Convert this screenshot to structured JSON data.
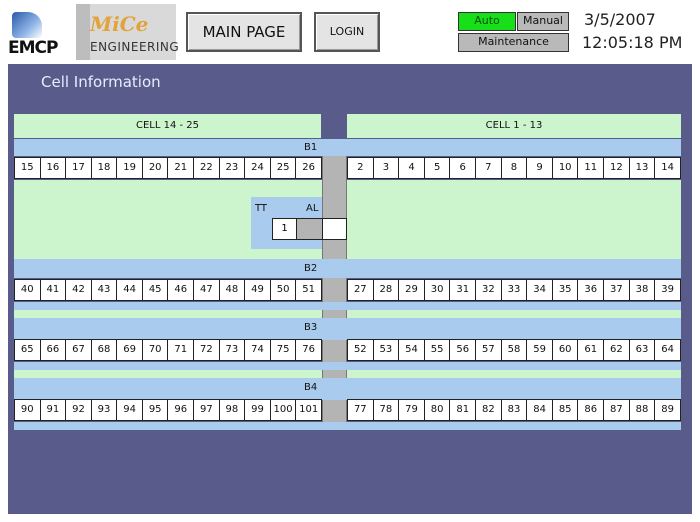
{
  "header": {
    "logo1_text": "EMCP",
    "logo2_brand": "MiCe",
    "logo2_sub": "ENGINEERING",
    "main_button": "MAIN PAGE",
    "login_button": "LOGIN",
    "mode_auto": "Auto",
    "mode_manual": "Manual",
    "mode_maintenance": "Maintenance",
    "date": "3/5/2007",
    "time": "12:05:18 PM"
  },
  "panel": {
    "title": "Cell Information",
    "left_header": "CELL 14 - 25",
    "right_header": "CELL 1 - 13",
    "tt_label": "TT",
    "al_label": "AL",
    "tt_value": "1",
    "rows": [
      {
        "label": "B1",
        "left": [
          "15",
          "16",
          "17",
          "18",
          "19",
          "20",
          "21",
          "22",
          "23",
          "24",
          "25",
          "26"
        ],
        "right": [
          "2",
          "3",
          "4",
          "5",
          "6",
          "7",
          "8",
          "9",
          "10",
          "11",
          "12",
          "13",
          "14"
        ]
      },
      {
        "label": "B2",
        "left": [
          "40",
          "41",
          "42",
          "43",
          "44",
          "45",
          "46",
          "47",
          "48",
          "49",
          "50",
          "51"
        ],
        "right": [
          "27",
          "28",
          "29",
          "30",
          "31",
          "32",
          "33",
          "34",
          "35",
          "36",
          "37",
          "38",
          "39"
        ]
      },
      {
        "label": "B3",
        "left": [
          "65",
          "66",
          "67",
          "68",
          "69",
          "70",
          "71",
          "72",
          "73",
          "74",
          "75",
          "76"
        ],
        "right": [
          "52",
          "53",
          "54",
          "55",
          "56",
          "57",
          "58",
          "59",
          "60",
          "61",
          "62",
          "63",
          "64"
        ]
      },
      {
        "label": "B4",
        "left": [
          "90",
          "91",
          "92",
          "93",
          "94",
          "95",
          "96",
          "97",
          "98",
          "99",
          "100",
          "101"
        ],
        "right": [
          "77",
          "78",
          "79",
          "80",
          "81",
          "82",
          "83",
          "84",
          "85",
          "86",
          "87",
          "88",
          "89"
        ]
      }
    ]
  }
}
